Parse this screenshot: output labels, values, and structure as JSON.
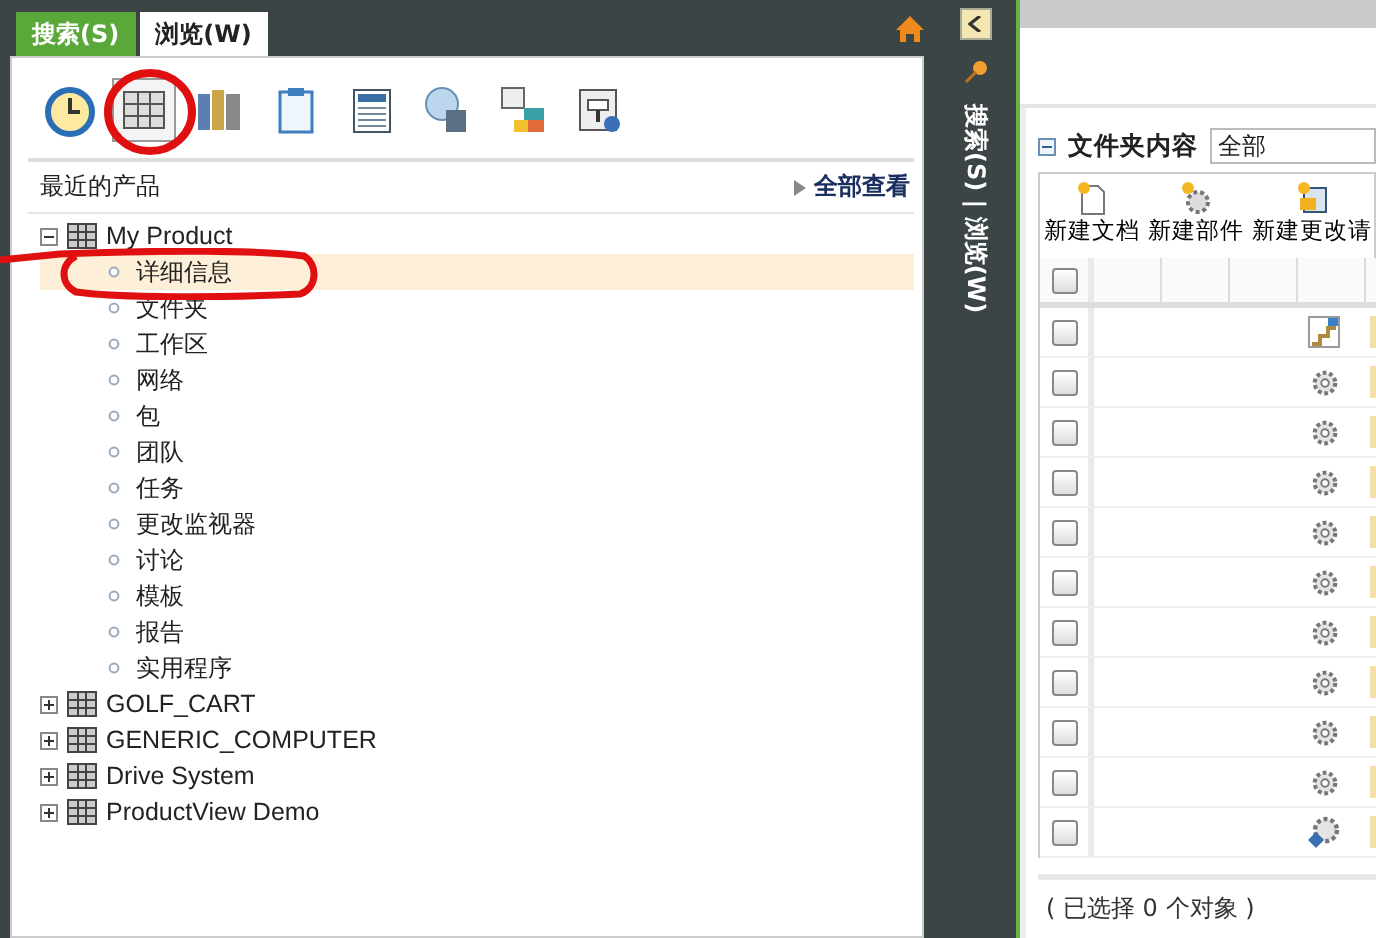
{
  "tabs": [
    {
      "label": "搜索(S)",
      "selected": false
    },
    {
      "label": "浏览(W)",
      "selected": true
    }
  ],
  "toolbar": [
    {
      "kind": "clock",
      "selected": false
    },
    {
      "kind": "grid",
      "selected": true
    },
    {
      "kind": "books",
      "selected": false
    },
    {
      "kind": "clipboard",
      "selected": false
    },
    {
      "kind": "sheet",
      "selected": false
    },
    {
      "kind": "shapes",
      "selected": false
    },
    {
      "kind": "tiles",
      "selected": false
    },
    {
      "kind": "form",
      "selected": false
    }
  ],
  "recent": {
    "title": "最近的产品",
    "view_all": "全部查看"
  },
  "tree": [
    {
      "label": "My Product",
      "expanded": true,
      "children": [
        {
          "label": "详细信息",
          "selected": true
        },
        {
          "label": "文件夹",
          "selected": false
        },
        {
          "label": "工作区",
          "selected": false
        },
        {
          "label": "网络",
          "selected": false
        },
        {
          "label": "包",
          "selected": false
        },
        {
          "label": "团队",
          "selected": false
        },
        {
          "label": "任务",
          "selected": false
        },
        {
          "label": "更改监视器",
          "selected": false
        },
        {
          "label": "讨论",
          "selected": false
        },
        {
          "label": "模板",
          "selected": false
        },
        {
          "label": "报告",
          "selected": false
        },
        {
          "label": "实用程序",
          "selected": false
        }
      ]
    },
    {
      "label": "GOLF_CART",
      "expanded": false
    },
    {
      "label": "GENERIC_COMPUTER",
      "expanded": false
    },
    {
      "label": "Drive System",
      "expanded": false
    },
    {
      "label": "ProductView Demo",
      "expanded": false
    }
  ],
  "side_strip": {
    "label": "搜索(S) | 浏览(W)"
  },
  "folder": {
    "title": "文件夹内容",
    "filter": "全部",
    "actions": [
      {
        "kind": "doc",
        "label": "新建文档"
      },
      {
        "kind": "part",
        "label": "新建部件"
      },
      {
        "kind": "change",
        "label": "新建更改请"
      }
    ],
    "header_checked": false,
    "rows": [
      {
        "kind": "stair",
        "checked": false
      },
      {
        "kind": "gear",
        "checked": false
      },
      {
        "kind": "gear",
        "checked": false
      },
      {
        "kind": "gear",
        "checked": false
      },
      {
        "kind": "gear",
        "checked": false
      },
      {
        "kind": "gear",
        "checked": false
      },
      {
        "kind": "gear",
        "checked": false
      },
      {
        "kind": "gear",
        "checked": false
      },
      {
        "kind": "gear",
        "checked": false
      },
      {
        "kind": "gear",
        "checked": false
      },
      {
        "kind": "blue-gear",
        "checked": false
      }
    ],
    "status": "( 已选择 0 个对象 )"
  }
}
